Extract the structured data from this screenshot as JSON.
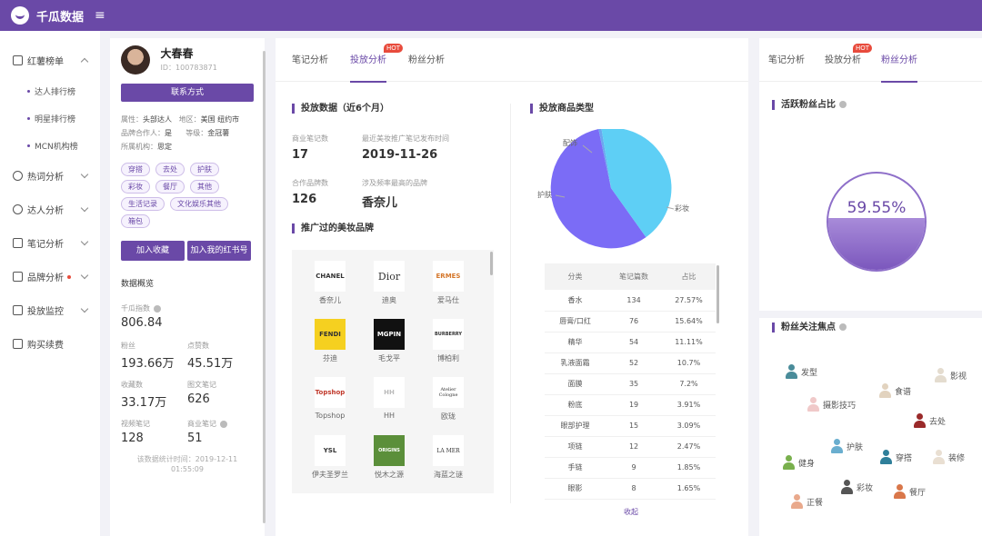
{
  "header": {
    "brand": "千瓜数据",
    "menu_icon": "menu-icon"
  },
  "nav": {
    "ranking": "红薯榜单",
    "sub": [
      "达人排行榜",
      "明星排行榜",
      "MCN机构榜"
    ],
    "items": [
      "热词分析",
      "达人分析",
      "笔记分析",
      "品牌分析",
      "投放监控",
      "购买续费"
    ]
  },
  "profile": {
    "name": "大春春",
    "id": "ID：100783871",
    "contact": "联系方式",
    "attr_l": "属性：",
    "attr_v": "头部达人",
    "region_l": "地区：",
    "region_v": "美国 纽约市",
    "brand_coop_l": "品牌合作人：",
    "brand_coop_v": "是",
    "level_l": "等级：",
    "level_v": "金冠薯",
    "agency_l": "所属机构：",
    "agency_v": "思定",
    "tags": [
      "穿搭",
      "去处",
      "护肤",
      "彩妆",
      "餐厅",
      "其他",
      "生活记录",
      "文化娱乐其他",
      "箱包"
    ],
    "btn_fav": "加入收藏",
    "btn_book": "加入我的红书号",
    "overview": "数据概览",
    "stats": [
      {
        "label": "千瓜指数",
        "value": "806.84"
      },
      {
        "label": "粉丝",
        "value": "193.66万"
      },
      {
        "label": "点赞数",
        "value": "45.51万"
      },
      {
        "label": "收藏数",
        "value": "33.17万"
      },
      {
        "label": "图文笔记",
        "value": "626"
      },
      {
        "label": "视频笔记",
        "value": "128"
      },
      {
        "label": "商业笔记",
        "value": "51"
      }
    ],
    "footer": "该数据统计时间：2019-12-11 01:55:09"
  },
  "middle": {
    "tabs": [
      "笔记分析",
      "投放分析",
      "粉丝分析"
    ],
    "hot": "HOT",
    "promo_title": "投放数据（近6个月）",
    "biz_notes_l": "商业笔记数",
    "biz_notes_v": "17",
    "latest_l": "最近美妆推广笔记发布时间",
    "latest_v": "2019-11-26",
    "coop_l": "合作品牌数",
    "coop_v": "126",
    "top_l": "涉及频率最高的品牌",
    "top_v": "香奈儿",
    "brands_title": "推广过的美妆品牌",
    "brands": [
      {
        "logo": "CHANEL",
        "name": "香奈儿"
      },
      {
        "logo": "Dior",
        "name": "迪奥"
      },
      {
        "logo": "ERMES",
        "name": "爱马仕"
      },
      {
        "logo": "FENDI",
        "name": "芬迪"
      },
      {
        "logo": "MGPIN",
        "name": "毛戈平"
      },
      {
        "logo": "BURBERRY",
        "name": "博柏利"
      },
      {
        "logo": "Topshop",
        "name": "Topshop"
      },
      {
        "logo": "HH",
        "name": "HH"
      },
      {
        "logo": "Atelier Cologne",
        "name": "欧珑"
      },
      {
        "logo": "YSL",
        "name": "伊夫圣罗兰"
      },
      {
        "logo": "ORIGINS",
        "name": "悦木之源"
      },
      {
        "logo": "LA MER",
        "name": "海蓝之谜"
      }
    ],
    "type_title": "投放商品类型",
    "pie_labels": [
      "配饰",
      "护肤",
      "彩妆"
    ],
    "table_head": [
      "分类",
      "笔记篇数",
      "占比"
    ],
    "table": [
      [
        "香水",
        "134",
        "27.57%"
      ],
      [
        "唇膏/口红",
        "76",
        "15.64%"
      ],
      [
        "精华",
        "54",
        "11.11%"
      ],
      [
        "乳液面霜",
        "52",
        "10.7%"
      ],
      [
        "面膜",
        "35",
        "7.2%"
      ],
      [
        "粉底",
        "19",
        "3.91%"
      ],
      [
        "眼部护理",
        "15",
        "3.09%"
      ],
      [
        "项链",
        "12",
        "2.47%"
      ],
      [
        "手链",
        "9",
        "1.85%"
      ],
      [
        "眼影",
        "8",
        "1.65%"
      ]
    ],
    "collapse": "收起"
  },
  "right": {
    "tabs": [
      "笔记分析",
      "投放分析",
      "粉丝分析"
    ],
    "hot": "HOT",
    "active_title": "活跃粉丝占比",
    "active_value": "59.55%",
    "focus_title": "粉丝关注焦点",
    "focus": [
      "发型",
      "影视",
      "摄影技巧",
      "食谱",
      "去处",
      "护肤",
      "穿搭",
      "装修",
      "健身",
      "彩妆",
      "餐厅",
      "正餐"
    ]
  },
  "colors": {
    "accent": "#6a49a7",
    "pie": [
      "#5ecff5",
      "#7b6cf6",
      "#6aa7ef"
    ]
  }
}
